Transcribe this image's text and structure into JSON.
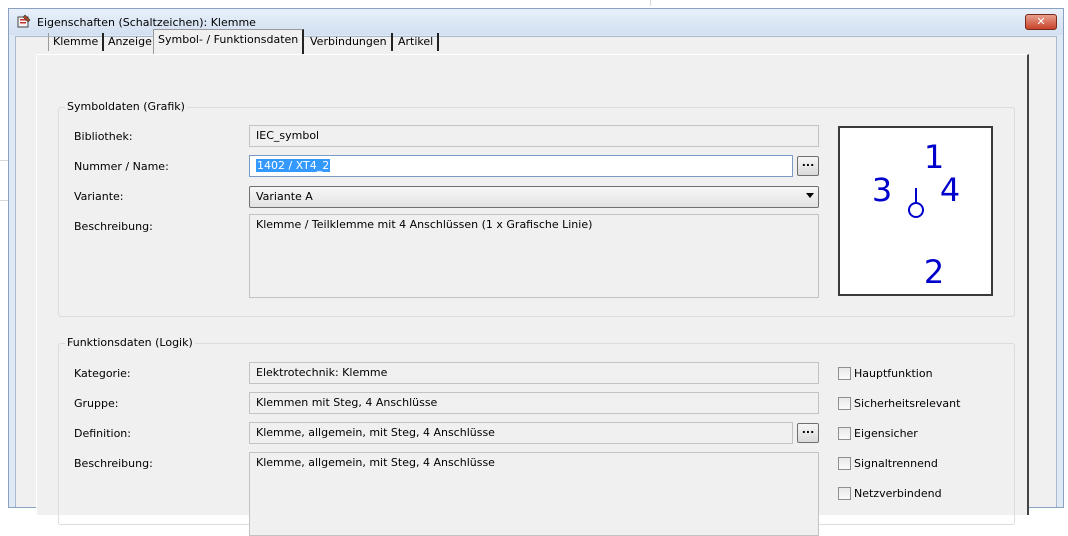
{
  "window": {
    "title": "Eigenschaften (Schaltzeichen): Klemme",
    "close_label": "✕"
  },
  "tabs": [
    {
      "label": "Klemme"
    },
    {
      "label": "Anzeige"
    },
    {
      "label": "Symbol- / Funktionsdaten"
    },
    {
      "label": "Verbindungen"
    },
    {
      "label": "Artikel"
    }
  ],
  "symboldaten": {
    "title": "Symboldaten (Grafik)",
    "bibliothek_label": "Bibliothek:",
    "bibliothek_value": "IEC_symbol",
    "nummer_label": "Nummer / Name:",
    "nummer_value": "1402 / XT4_2",
    "variante_label": "Variante:",
    "variante_value": "Variante A",
    "beschreibung_label": "Beschreibung:",
    "beschreibung_value": "Klemme / Teilklemme mit 4 Anschlüssen (1 x Grafische Linie)",
    "browse_label": "..."
  },
  "preview": {
    "n1": "1",
    "n2": "2",
    "n3": "3",
    "n4": "4",
    "color": "#0000cc"
  },
  "funktionsdaten": {
    "title": "Funktionsdaten (Logik)",
    "kategorie_label": "Kategorie:",
    "kategorie_value": "Elektrotechnik: Klemme",
    "gruppe_label": "Gruppe:",
    "gruppe_value": "Klemmen mit Steg, 4 Anschlüsse",
    "definition_label": "Definition:",
    "definition_value": "Klemme, allgemein, mit Steg, 4 Anschlüsse",
    "beschreibung_label": "Beschreibung:",
    "beschreibung_value": "Klemme, allgemein, mit Steg, 4 Anschlüsse",
    "browse_label": "..."
  },
  "checkboxes": [
    {
      "label": "Hauptfunktion",
      "checked": false
    },
    {
      "label": "Sicherheitsrelevant",
      "checked": false
    },
    {
      "label": "Eigensicher",
      "checked": false
    },
    {
      "label": "Signaltrennend",
      "checked": false
    },
    {
      "label": "Netzverbindend",
      "checked": false
    }
  ]
}
